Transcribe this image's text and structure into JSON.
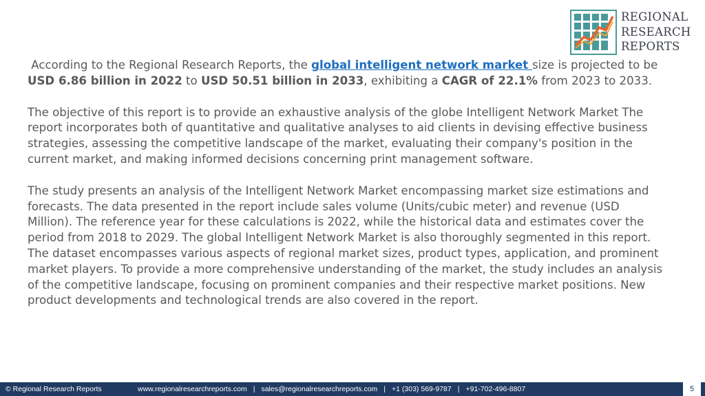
{
  "logo": {
    "line1": "REGIONAL",
    "line2": "RESEARCH",
    "line3": "REPORTS",
    "icon": "bar-chart-trend-icon",
    "colors": {
      "grid": "#4a9a9a",
      "trend": "#e8642a",
      "frame": "#4a9a9a"
    }
  },
  "intro": {
    "t1": "According to the Regional Research Reports, the ",
    "link": "global intelligent network market ",
    "t2": "size is projected to be ",
    "b1": "USD 6.86 billion in 2022",
    "t3": " to ",
    "b2": "USD 50.51 billion in 2033",
    "t4": ", exhibiting a ",
    "b3": "CAGR of 22.1%",
    "t5": " from 2023 to 2033."
  },
  "objective": "The objective of this report is to provide an exhaustive analysis of the globe Intelligent Network Market The report incorporates both of quantitative and qualitative analyses to aid clients in devising effective business strategies, assessing the competitive landscape of the market, evaluating their company's position in the current market, and making informed decisions concerning print management software.",
  "study": "The study presents an analysis of the Intelligent Network Market encompassing market size estimations and forecasts. The data presented in the report include sales volume (Units/cubic meter) and revenue (USD Million). The reference year for these calculations is 2022, while the historical data and estimates cover the period from 2018 to 2029. The global Intelligent Network Market is also thoroughly segmented in this report. The dataset encompasses various aspects of regional market sizes, product types, application, and prominent market players. To provide a more comprehensive understanding of the market, the study includes an analysis of the competitive landscape, focusing on prominent companies and their respective market positions. New product developments and technological trends are also covered in the report.",
  "footer": {
    "copyright": "© Regional Research Reports",
    "website": "www.regionalresearchreports.com",
    "separator": "|",
    "email": "sales@regionalresearchreports.com",
    "phone1": "+1 (303) 569-9787",
    "phone2": "+91-702-496-8807",
    "page": "5",
    "bg_color": "#203a62"
  }
}
